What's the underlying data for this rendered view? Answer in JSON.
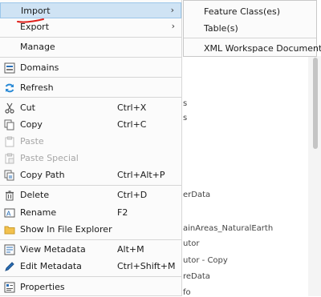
{
  "menu": {
    "items": [
      {
        "key": "import",
        "label": "Import",
        "has_submenu": true
      },
      {
        "key": "export",
        "label": "Export",
        "has_submenu": true
      },
      {
        "key": "manage",
        "label": "Manage"
      },
      {
        "key": "domains",
        "label": "Domains",
        "icon": "domains-icon"
      },
      {
        "key": "refresh",
        "label": "Refresh",
        "icon": "refresh-icon"
      },
      {
        "key": "cut",
        "label": "Cut",
        "shortcut": "Ctrl+X",
        "icon": "scissors-icon"
      },
      {
        "key": "copy",
        "label": "Copy",
        "shortcut": "Ctrl+C",
        "icon": "copy-icon"
      },
      {
        "key": "paste",
        "label": "Paste",
        "disabled": true,
        "icon": "paste-icon"
      },
      {
        "key": "paste_special",
        "label": "Paste Special",
        "disabled": true,
        "icon": "paste-special-icon"
      },
      {
        "key": "copy_path",
        "label": "Copy Path",
        "shortcut": "Ctrl+Alt+P",
        "icon": "copy-path-icon"
      },
      {
        "key": "delete",
        "label": "Delete",
        "shortcut": "Ctrl+D",
        "icon": "trash-icon"
      },
      {
        "key": "rename",
        "label": "Rename",
        "shortcut": "F2",
        "icon": "rename-icon"
      },
      {
        "key": "show_in_file_explorer",
        "label": "Show In File Explorer",
        "icon": "folder-icon"
      },
      {
        "key": "view_metadata",
        "label": "View Metadata",
        "shortcut": "Alt+M",
        "icon": "view-metadata-icon"
      },
      {
        "key": "edit_metadata",
        "label": "Edit Metadata",
        "shortcut": "Ctrl+Shift+M",
        "icon": "edit-metadata-icon"
      },
      {
        "key": "properties",
        "label": "Properties",
        "icon": "properties-icon"
      }
    ]
  },
  "submenu": {
    "items": [
      {
        "label": "Feature Class(es)"
      },
      {
        "label": "Table(s)"
      },
      {
        "label": "XML Workspace Document"
      }
    ]
  },
  "background": {
    "list_fragments": [
      "s",
      "s",
      "erData",
      "ainAreas_NaturalEarth",
      "utor",
      "utor - Copy",
      "reData",
      "fo"
    ]
  },
  "colors": {
    "hover_bg": "#cfe3f4",
    "annotation_red": "#e0201b",
    "icon_blue": "#2a6fb7"
  }
}
